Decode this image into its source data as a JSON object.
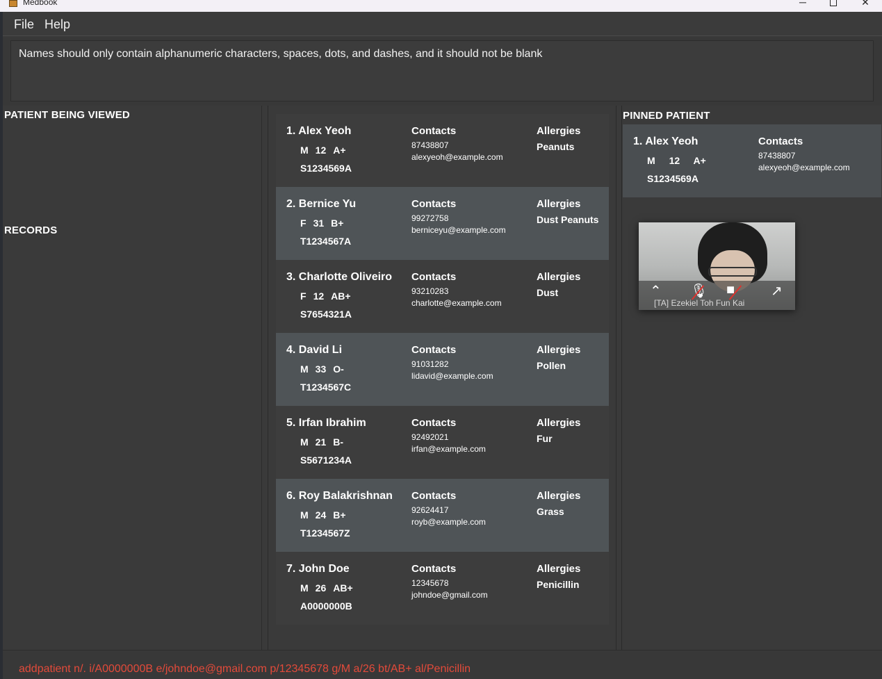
{
  "window": {
    "title": "Medbook",
    "controls": {
      "minimize": "─",
      "close": "✕"
    }
  },
  "menu": {
    "file": "File",
    "help": "Help"
  },
  "result": {
    "message": "Names should only contain alphanumeric characters, spaces, dots, and dashes, and it should not be blank"
  },
  "sections": {
    "viewed": "PATIENT BEING VIEWED",
    "records": "RECORDS",
    "pinned": "PINNED PATIENT"
  },
  "labels": {
    "contacts": "Contacts",
    "allergies": "Allergies"
  },
  "patients": [
    {
      "name": "1. Alex Yeoh",
      "gender": "M",
      "age": "12",
      "blood": "A+",
      "ic": "S1234569A",
      "phone": "87438807",
      "email": "alexyeoh@example.com",
      "allergies": "Peanuts"
    },
    {
      "name": "2. Bernice Yu",
      "gender": "F",
      "age": "31",
      "blood": "B+",
      "ic": "T1234567A",
      "phone": "99272758",
      "email": "berniceyu@example.com",
      "allergies": "Dust Peanuts"
    },
    {
      "name": "3. Charlotte Oliveiro",
      "gender": "F",
      "age": "12",
      "blood": "AB+",
      "ic": "S7654321A",
      "phone": "93210283",
      "email": "charlotte@example.com",
      "allergies": "Dust"
    },
    {
      "name": "4. David Li",
      "gender": "M",
      "age": "33",
      "blood": "O-",
      "ic": "T1234567C",
      "phone": "91031282",
      "email": "lidavid@example.com",
      "allergies": "Pollen"
    },
    {
      "name": "5. Irfan Ibrahim",
      "gender": "M",
      "age": "21",
      "blood": "B-",
      "ic": "S5671234A",
      "phone": "92492021",
      "email": "irfan@example.com",
      "allergies": "Fur"
    },
    {
      "name": "6. Roy Balakrishnan",
      "gender": "M",
      "age": "24",
      "blood": "B+",
      "ic": "T1234567Z",
      "phone": "92624417",
      "email": "royb@example.com",
      "allergies": "Grass"
    },
    {
      "name": "7. John Doe",
      "gender": "M",
      "age": "26",
      "blood": "AB+",
      "ic": "A0000000B",
      "phone": "12345678",
      "email": "johndoe@gmail.com",
      "allergies": "Penicillin"
    }
  ],
  "pinned": {
    "name": "1. Alex Yeoh",
    "gender": "M",
    "age": "12",
    "blood": "A+",
    "ic": "S1234569A",
    "phone": "87438807",
    "email": "alexyeoh@example.com"
  },
  "video": {
    "participant": "[TA] Ezekiel Toh Fun Kai"
  },
  "command": {
    "text": "addpatient n/. i/A0000000B e/johndoe@gmail.com p/12345678 g/M a/26 bt/AB+ al/Penicillin"
  }
}
